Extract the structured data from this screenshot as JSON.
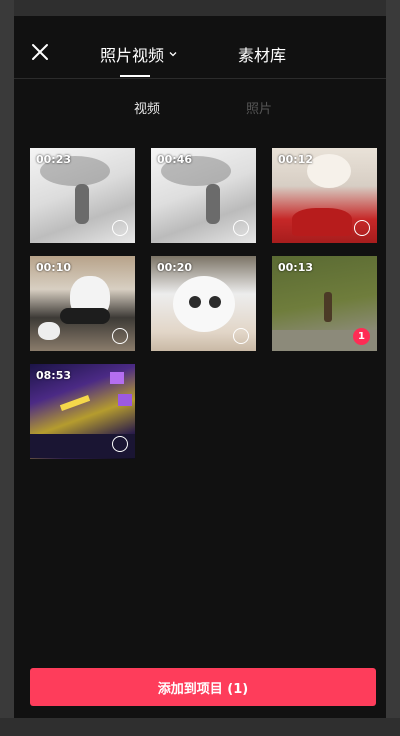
{
  "header": {
    "close_icon": "close-icon",
    "tab_photos_videos": "照片视频",
    "tab_library": "素材库"
  },
  "subtabs": {
    "video": "视频",
    "photo": "照片"
  },
  "media": [
    {
      "duration": "00:23",
      "selected": false
    },
    {
      "duration": "00:46",
      "selected": false
    },
    {
      "duration": "00:12",
      "selected": false
    },
    {
      "duration": "00:10",
      "selected": false
    },
    {
      "duration": "00:20",
      "selected": false
    },
    {
      "duration": "00:13",
      "selected": true,
      "selection_index": "1"
    },
    {
      "duration": "08:53",
      "selected": false
    }
  ],
  "footer": {
    "add_button": "添加到项目 (1)"
  },
  "colors": {
    "background": "#111111",
    "accent": "#fe3d5b"
  }
}
